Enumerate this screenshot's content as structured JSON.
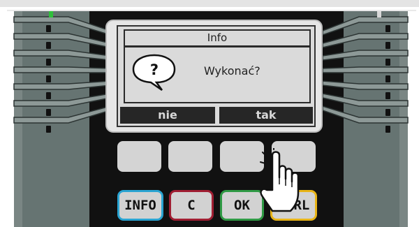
{
  "dialog": {
    "title": "Info",
    "icon": "question-bubble-icon",
    "question_mark": "?",
    "message": "Wykonać?"
  },
  "softkeys": {
    "left_label": "nie",
    "right_label": "tak"
  },
  "function_keys": [
    {
      "label": ""
    },
    {
      "label": ""
    },
    {
      "label": ""
    },
    {
      "label": ""
    }
  ],
  "hardware_keys": [
    {
      "label": "INFO",
      "color": "#2aa4d2"
    },
    {
      "label": "C",
      "color": "#a01e32"
    },
    {
      "label": "OK",
      "color": "#2f9a45"
    },
    {
      "label": "CTRL",
      "color": "#e8b418"
    }
  ],
  "image_reference": "HPT_ZAK",
  "colors": {
    "device_body": "#111111",
    "side_panel": "#667472",
    "led_green": "#2fbf3a",
    "display_bg": "#dadada"
  },
  "pointer_icon": "hand-pointer-icon"
}
